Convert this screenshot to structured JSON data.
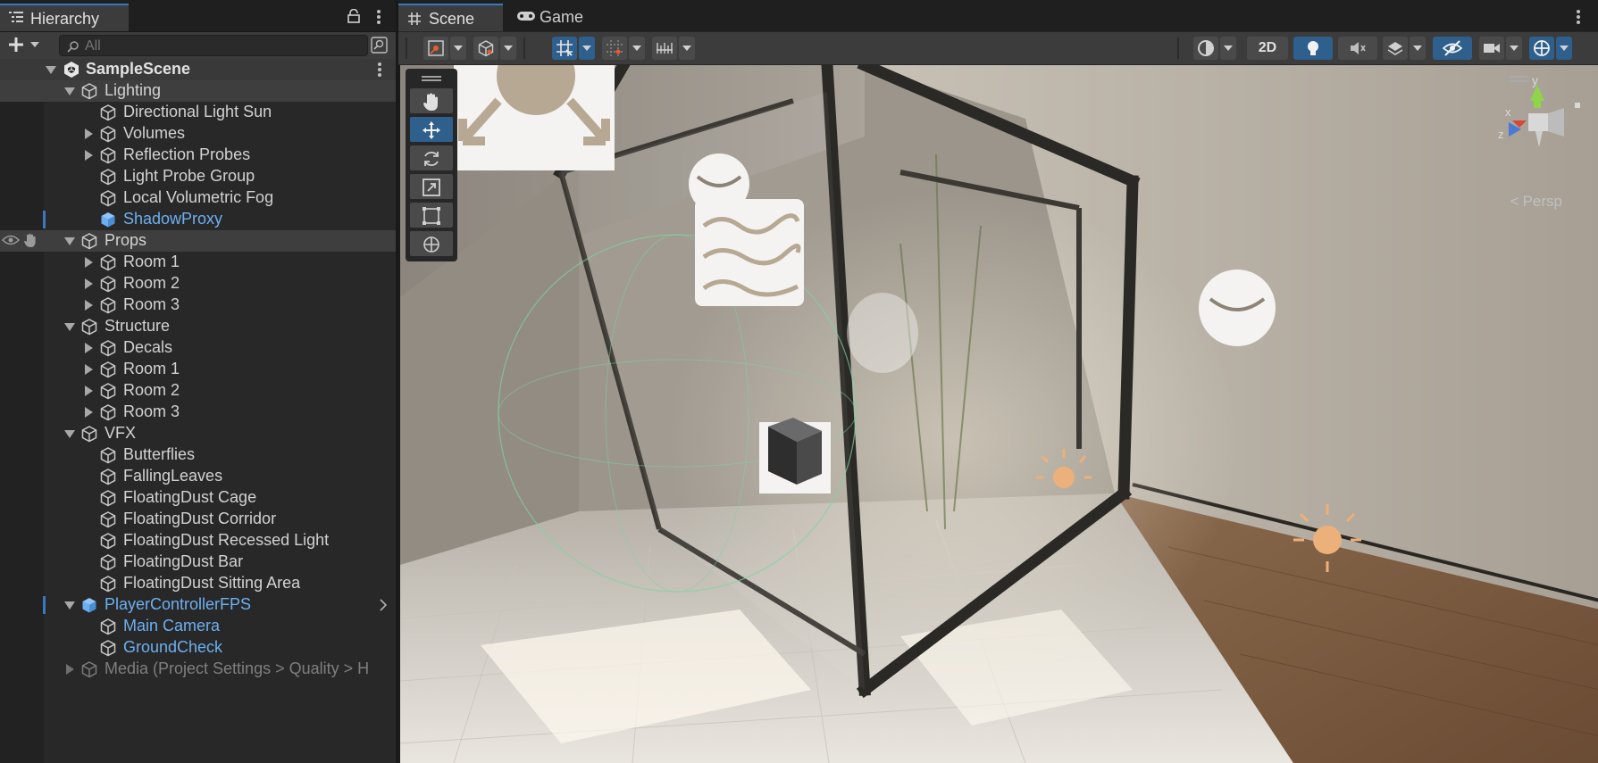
{
  "hierarchy": {
    "tab_label": "Hierarchy",
    "search_placeholder": "All",
    "scene_name": "SampleScene",
    "rows": [
      {
        "label": "Lighting"
      },
      {
        "label": "Directional Light Sun"
      },
      {
        "label": "Volumes"
      },
      {
        "label": "Reflection Probes"
      },
      {
        "label": "Light Probe Group"
      },
      {
        "label": "Local Volumetric Fog"
      },
      {
        "label": "ShadowProxy"
      },
      {
        "label": "Props"
      },
      {
        "label": "Room 1"
      },
      {
        "label": "Room 2"
      },
      {
        "label": "Room 3"
      },
      {
        "label": "Structure"
      },
      {
        "label": "Decals"
      },
      {
        "label": "Room 1"
      },
      {
        "label": "Room 2"
      },
      {
        "label": "Room 3"
      },
      {
        "label": "VFX"
      },
      {
        "label": "Butterflies"
      },
      {
        "label": "FallingLeaves"
      },
      {
        "label": "FloatingDust Cage"
      },
      {
        "label": "FloatingDust Corridor"
      },
      {
        "label": "FloatingDust Recessed Light"
      },
      {
        "label": "FloatingDust Bar"
      },
      {
        "label": "FloatingDust Sitting Area"
      },
      {
        "label": "PlayerControllerFPS"
      },
      {
        "label": "Main Camera"
      },
      {
        "label": "GroundCheck"
      },
      {
        "label": "Media (Project Settings > Quality > H"
      }
    ]
  },
  "scene": {
    "tabs": [
      {
        "label": "Scene"
      },
      {
        "label": "Game"
      }
    ],
    "toolbar": {
      "toggle_2d": "2D"
    },
    "camera": {
      "projection": "Persp",
      "axis_y": "y",
      "axis_x": "x",
      "axis_z": "z"
    }
  },
  "colors": {
    "accent": "#3a79bb",
    "selected_text": "#6cb0f2",
    "prefab_icon": "#6cb0f2"
  }
}
